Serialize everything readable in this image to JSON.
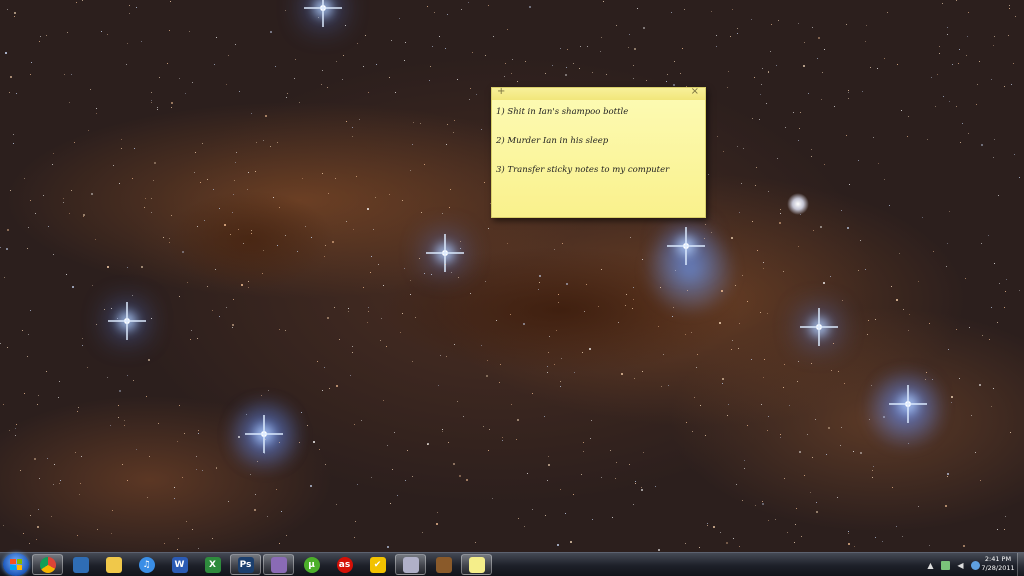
{
  "sticky_note": {
    "add_symbol": "+",
    "close_symbol": "×",
    "lines": [
      "1) Shit in Ian's shampoo bottle",
      "2) Murder Ian in his sleep",
      "3) Transfer sticky notes to my computer"
    ]
  },
  "taskbar": {
    "start_icon": "windows-start-orb",
    "pinned": [
      {
        "icon": "chrome-icon",
        "glyph": "",
        "color": "#e3a21a",
        "active": true
      },
      {
        "icon": "thunderbird-icon",
        "glyph": "",
        "color": "#2f6db5",
        "active": false
      },
      {
        "icon": "folder-icon",
        "glyph": "",
        "color": "#f0c84a",
        "active": false
      },
      {
        "icon": "itunes-icon",
        "glyph": "♫",
        "color": "#3a8ee6",
        "active": false
      },
      {
        "icon": "word-icon",
        "glyph": "W",
        "color": "#2b5bb5",
        "active": false
      },
      {
        "icon": "excel-icon",
        "glyph": "X",
        "color": "#2e8b3d",
        "active": false
      },
      {
        "icon": "photoshop-icon",
        "glyph": "Ps",
        "color": "#1b3f6e",
        "active": true
      },
      {
        "icon": "app-icon",
        "glyph": "",
        "color": "#8a6bb5",
        "active": true
      },
      {
        "icon": "utorrent-icon",
        "glyph": "µ",
        "color": "#4caf2a",
        "active": false
      },
      {
        "icon": "lastfm-icon",
        "glyph": "as",
        "color": "#d51007",
        "active": false
      },
      {
        "icon": "norton-icon",
        "glyph": "✔",
        "color": "#f2c200",
        "active": false
      },
      {
        "icon": "paint-icon",
        "glyph": "",
        "color": "#b0b0c8",
        "active": true
      },
      {
        "icon": "library-icon",
        "glyph": "",
        "color": "#8a5a2a",
        "active": false
      },
      {
        "icon": "sticky-notes-icon",
        "glyph": "",
        "color": "#f5ee8a",
        "active": true
      }
    ],
    "clock_time": "2:41 PM",
    "clock_date": "7/28/2011",
    "tray_icons": [
      "show-hidden-icons",
      "network-icon",
      "volume-icon",
      "action-center-icon"
    ]
  },
  "colors": {
    "sticky_bg": "#fdf8a6",
    "taskbar_bg": "#1d2029"
  }
}
